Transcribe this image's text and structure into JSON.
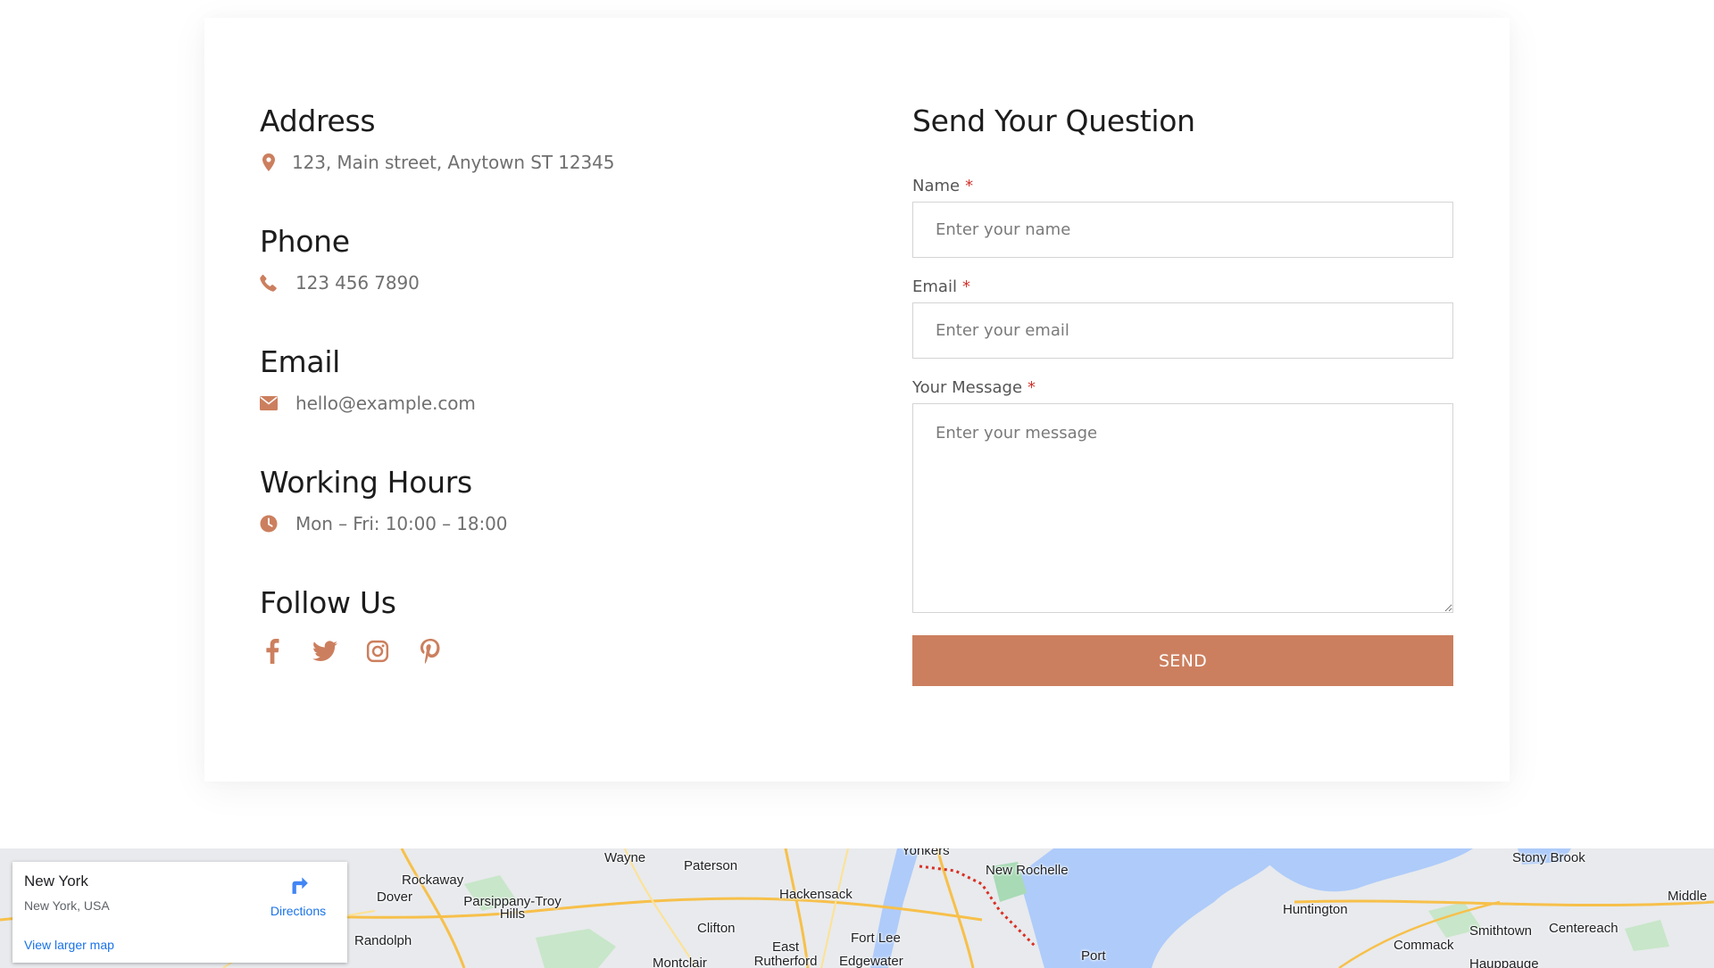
{
  "contact": {
    "address": {
      "heading": "Address",
      "value": "123, Main street, Anytown ST 12345",
      "icon": "map-pin-icon"
    },
    "phone": {
      "heading": "Phone",
      "value": "123 456 7890",
      "icon": "phone-icon"
    },
    "email": {
      "heading": "Email",
      "value": "hello@example.com",
      "icon": "envelope-icon"
    },
    "hours": {
      "heading": "Working Hours",
      "value": "Mon – Fri: 10:00 – 18:00",
      "icon": "clock-icon"
    },
    "follow": {
      "heading": "Follow Us",
      "icons": [
        "facebook-icon",
        "twitter-icon",
        "instagram-icon",
        "pinterest-icon"
      ]
    }
  },
  "form": {
    "title": "Send Your Question",
    "required_mark": "*",
    "name": {
      "label": "Name",
      "placeholder": "Enter your name",
      "value": ""
    },
    "email": {
      "label": "Email",
      "placeholder": "Enter your email",
      "value": ""
    },
    "message": {
      "label": "Your Message",
      "placeholder": "Enter your message",
      "value": ""
    },
    "submit_label": "SEND"
  },
  "map": {
    "place_name": "New York",
    "place_address": "New York, USA",
    "directions_label": "Directions",
    "larger_map_label": "View larger map",
    "labels": [
      "Wayne",
      "Paterson",
      "Yonkers",
      "New Rochelle",
      "Stony Brook",
      "Rockaway",
      "Dover",
      "Parsippany-Troy Hills",
      "Hackensack",
      "Huntington",
      "Middle",
      "Randolph",
      "Clifton",
      "East Rutherford",
      "Fort Lee",
      "Edgewater",
      "Montclair",
      "Commack",
      "Smithtown",
      "Centereach",
      "Hauppauge",
      "Port"
    ]
  },
  "colors": {
    "accent": "#cc7f5e",
    "heading": "#1c1c1c",
    "muted": "#707070",
    "required": "#d0342c",
    "map_link": "#1a73e8"
  }
}
